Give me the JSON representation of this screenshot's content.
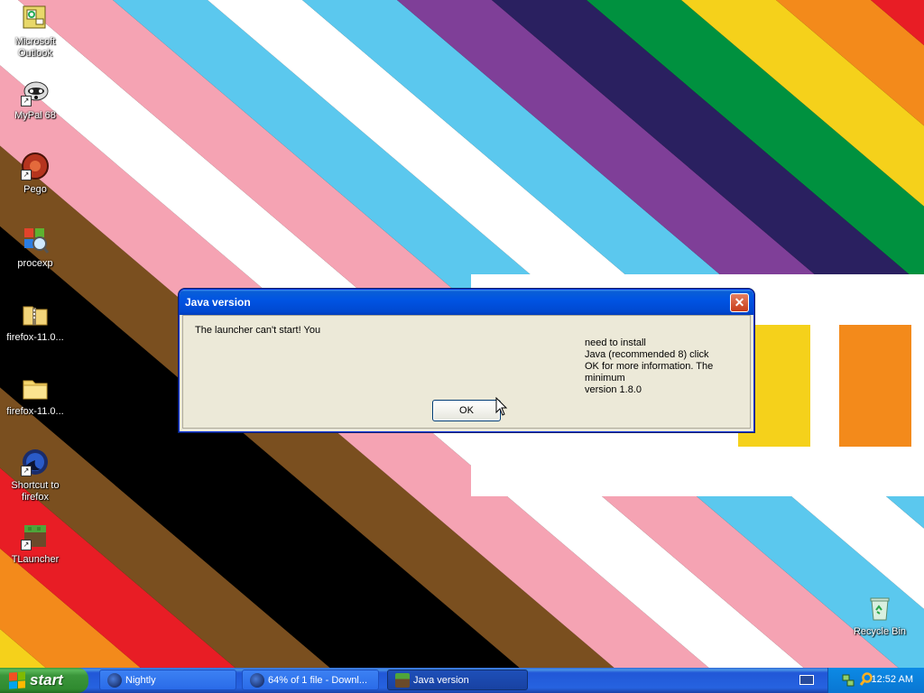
{
  "desktop": {
    "icons": [
      {
        "label": "Microsoft Outlook",
        "icon": "outlook-icon"
      },
      {
        "label": "MyPal 68",
        "icon": "mypal-icon"
      },
      {
        "label": "Pego",
        "icon": "pego-icon"
      },
      {
        "label": "procexp",
        "icon": "procexp-icon"
      },
      {
        "label": "firefox-11.0...",
        "icon": "zip-folder-icon"
      },
      {
        "label": "firefox-11.0...",
        "icon": "folder-icon"
      },
      {
        "label": "Shortcut to firefox",
        "icon": "firefox-icon"
      },
      {
        "label": "TLauncher",
        "icon": "tlauncher-icon"
      },
      {
        "label": "Recycle Bin",
        "icon": "recycle-bin-icon"
      }
    ]
  },
  "dialog": {
    "title": "Java version",
    "message_line1": "The launcher can't start! You",
    "message_rest": [
      "need to install",
      "Java (recommended 8) click",
      "OK for more information. The minimum",
      "version 1.8.0"
    ],
    "ok_label": "OK",
    "close_glyph": "✕"
  },
  "taskbar": {
    "start_label": "start",
    "tasks": [
      {
        "label": "Nightly",
        "active": false
      },
      {
        "label": "64% of 1 file - Downl...",
        "active": false
      },
      {
        "label": "Java version",
        "active": true
      }
    ],
    "clock": "12:52 AM"
  },
  "colors": {
    "titlebar": "#0054e3",
    "taskbar": "#2663e0",
    "start": "#3b963b"
  }
}
